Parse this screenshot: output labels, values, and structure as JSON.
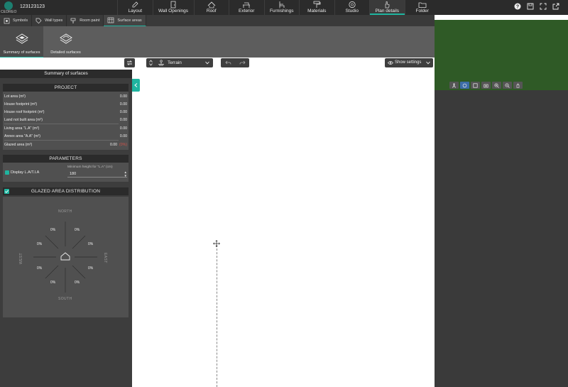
{
  "app": {
    "logo_text": "CEDREO",
    "project_name": "123123123"
  },
  "nav": [
    {
      "id": "layout",
      "label": "Layout",
      "icon": "pencil-icon"
    },
    {
      "id": "wall-openings",
      "label": "Wall Openings",
      "icon": "door-icon"
    },
    {
      "id": "roof",
      "label": "Roof",
      "icon": "roof-icon"
    },
    {
      "id": "exterior",
      "label": "Exterior",
      "icon": "bench-icon"
    },
    {
      "id": "furnishings",
      "label": "Furnishings",
      "icon": "chair-icon"
    },
    {
      "id": "materials",
      "label": "Materials",
      "icon": "paint-roller-icon"
    },
    {
      "id": "studio",
      "label": "Studio",
      "icon": "aperture-icon"
    },
    {
      "id": "plan-details",
      "label": "Plan details",
      "icon": "hand-pointer-icon",
      "active": true
    },
    {
      "id": "folder",
      "label": "Folder",
      "icon": "folder-icon"
    }
  ],
  "top_right": [
    "help-icon",
    "save-icon",
    "fullscreen-icon",
    "export-icon"
  ],
  "subtabs": [
    {
      "label": "Symbols",
      "icon": "symbol-icon"
    },
    {
      "label": "Wall types",
      "icon": "tag-icon"
    },
    {
      "label": "Room paint",
      "icon": "paint-icon"
    },
    {
      "label": "Surface areas",
      "icon": "table-icon",
      "active": true
    }
  ],
  "ribbon": [
    {
      "label": "Summary of surfaces",
      "icon": "layers-icon",
      "active": true
    },
    {
      "label": "Detailed surfaces",
      "icon": "layers-detail-icon"
    }
  ],
  "toolbar": {
    "terrain_label": "Terrain",
    "show_settings_label": "Show settings"
  },
  "panel": {
    "title": "Summary of surfaces",
    "project_head": "PROJECT",
    "project_rows": [
      {
        "label": "Lot area (m²)",
        "value": "0.00"
      },
      {
        "label": "House footprint (m²)",
        "value": "0.00"
      },
      {
        "label": "House roof footprint (m²)",
        "value": "0.00"
      },
      {
        "label": "Land not built area (m²)",
        "value": "0.00"
      },
      {
        "label": "Living area \"L.A\" (m²)",
        "value": "0.00"
      },
      {
        "label": "Annex area \"A.A\" (m²)",
        "value": "0.00"
      },
      {
        "label": "Glazed area (m²)",
        "value": "0.00",
        "extra": "(0%)"
      }
    ],
    "params_head": "PARAMETERS",
    "display_lati_label": "Display L.A/T.I.A",
    "min_height_caption": "Minimum height for \"L.A\" (cm)",
    "min_height_value": "180",
    "glazed_head": "GLAZED AREA DISTRIBUTION",
    "compass": {
      "north": "NORTH",
      "south": "SOUTH",
      "east": "EAST",
      "west": "WEST",
      "n": "0%",
      "nne": "0%",
      "nnw": "0%",
      "ene": "0%",
      "wnw": "0%",
      "ese": "0%",
      "wsw": "0%",
      "sse": "0%",
      "ssw": "0%"
    }
  },
  "colors": {
    "accent": "#1fb5a0",
    "dark": "#2b2b2b",
    "panel": "#3d3d3d",
    "terrain_green": "#2f5a26"
  }
}
